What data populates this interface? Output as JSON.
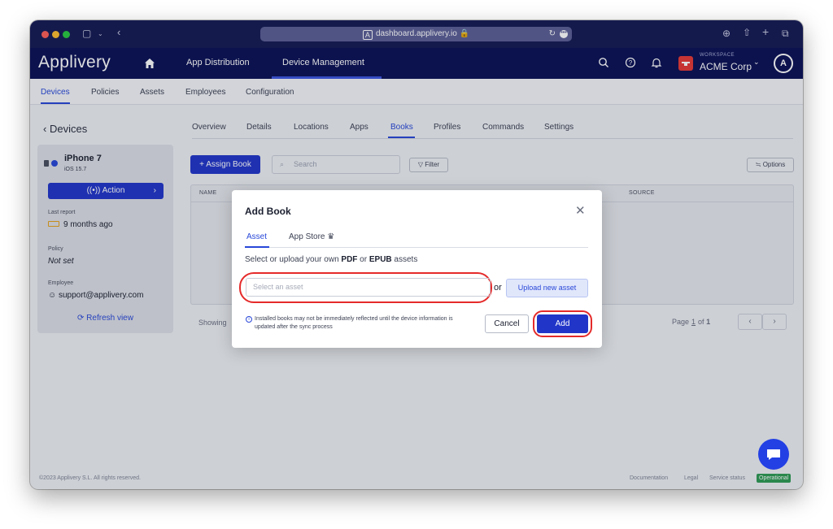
{
  "browser": {
    "url": "dashboard.applivery.io",
    "url_icon": "A",
    "traffic_lights": {
      "close": "#fe5f57",
      "minimize": "#febc2e",
      "maximize": "#28c840"
    }
  },
  "app": {
    "logo": "Applivery",
    "top_nav": [
      "App Distribution",
      "Device Management"
    ],
    "active_top_nav": "Device Management",
    "workspace_label": "WORKSPACE",
    "workspace_name": "ACME Corp",
    "avatar": "A"
  },
  "subnav": {
    "items": [
      "Devices",
      "Policies",
      "Assets",
      "Employees",
      "Configuration"
    ],
    "active": "Devices"
  },
  "sidebar": {
    "back_label": "Devices",
    "device_name": "iPhone 7",
    "device_os": "iOS 15.7",
    "action_label": "Action",
    "last_report_label": "Last report",
    "last_report_value": "9 months ago",
    "policy_label": "Policy",
    "policy_value": "Not set",
    "employee_label": "Employee",
    "employee_value": "support@applivery.com",
    "refresh_label": "Refresh view"
  },
  "device_tabs": {
    "items": [
      "Overview",
      "Details",
      "Locations",
      "Apps",
      "Books",
      "Profiles",
      "Commands",
      "Settings"
    ],
    "active": "Books"
  },
  "toolbar": {
    "assign_label": "+ Assign Book",
    "search_placeholder": "Search",
    "filter_label": "Filter",
    "options_label": "Options"
  },
  "table": {
    "columns": [
      "NAME",
      "SOURCE"
    ]
  },
  "pagination": {
    "showing": "Showing",
    "page_label": "Page",
    "current_page": "1",
    "of_label": "of",
    "total_pages": "1"
  },
  "footer": {
    "copyright": "©2023 Applivery S.L. All rights reserved.",
    "links": [
      "Documentation",
      "Legal",
      "Service status"
    ],
    "status_badge": "Operational",
    "status_color": "#2e9a54"
  },
  "modal": {
    "title": "Add Book",
    "tabs": [
      "Asset",
      "App Store"
    ],
    "active_tab": "Asset",
    "desc_prefix": "Select or upload your own ",
    "desc_pdf": "PDF",
    "desc_or": " or ",
    "desc_epub": "EPUB",
    "desc_suffix": " assets",
    "asset_placeholder": "Select an asset",
    "or_label": "or",
    "upload_label": "Upload new asset",
    "info_text": "Installed books may not be immediately reflected until the device information is updated after the sync process",
    "cancel_label": "Cancel",
    "add_label": "Add",
    "highlight_color": "#e52a2a"
  },
  "colors": {
    "brand_dark": "#0b1155",
    "accent": "#2136c9"
  }
}
